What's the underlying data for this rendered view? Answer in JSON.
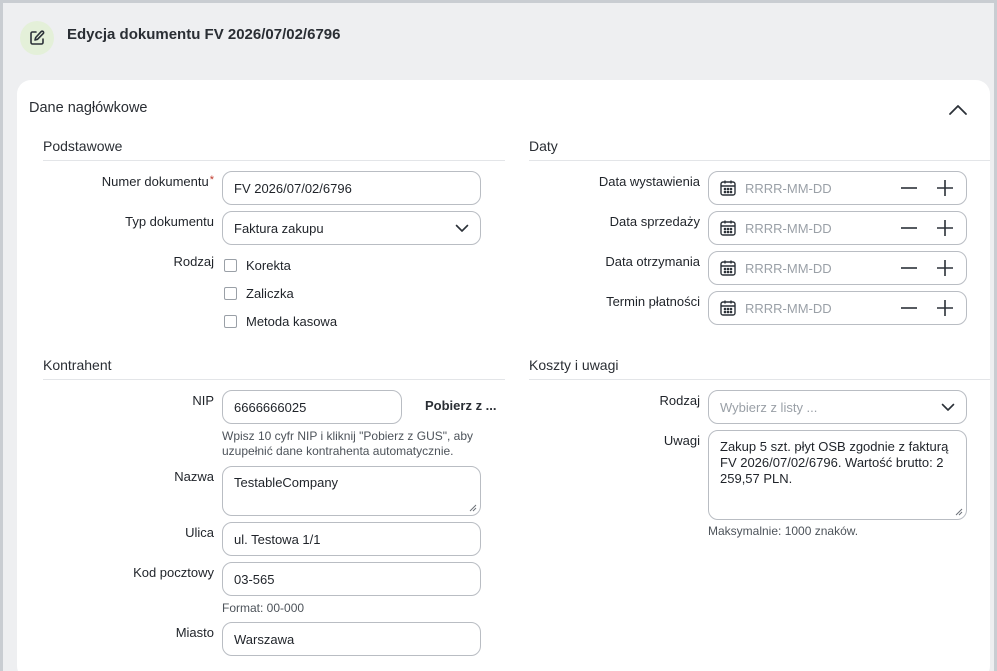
{
  "page": {
    "title": "Edycja dokumentu FV 2026/07/02/6796"
  },
  "header_section": {
    "title": "Dane nagłówkowe"
  },
  "basic": {
    "title": "Podstawowe",
    "doc_number_label": "Numer dokumentu",
    "required_mark": "*",
    "doc_number_value": "FV 2026/07/02/6796",
    "doc_type_label": "Typ dokumentu",
    "doc_type_value": "Faktura zakupu",
    "kind_label": "Rodzaj",
    "checkboxes": [
      {
        "label": "Korekta",
        "checked": false
      },
      {
        "label": "Zaliczka",
        "checked": false
      },
      {
        "label": "Metoda kasowa",
        "checked": false
      }
    ]
  },
  "dates": {
    "title": "Daty",
    "placeholder": "RRRR-MM-DD",
    "fields": [
      {
        "label": "Data wystawienia",
        "value": ""
      },
      {
        "label": "Data sprzedaży",
        "value": ""
      },
      {
        "label": "Data otrzymania",
        "value": ""
      },
      {
        "label": "Termin płatności",
        "value": ""
      }
    ]
  },
  "contractor": {
    "title": "Kontrahent",
    "nip_label": "NIP",
    "nip_value": "6666666025",
    "gus_button": "Pobierz z ...",
    "nip_hint": "Wpisz 10 cyfr NIP i kliknij \"Pobierz z GUS\", aby uzupełnić dane kontrahenta automatycznie.",
    "name_label": "Nazwa",
    "name_value": "TestableCompany",
    "street_label": "Ulica",
    "street_value": "ul. Testowa 1/1",
    "postal_label": "Kod pocztowy",
    "postal_value": "03-565",
    "postal_hint": "Format: 00-000",
    "city_label": "Miasto",
    "city_value": "Warszawa"
  },
  "costs": {
    "title": "Koszty i uwagi",
    "kind_label": "Rodzaj",
    "kind_placeholder": "Wybierz z listy ...",
    "notes_label": "Uwagi",
    "notes_value": "Zakup 5 szt. płyt OSB zgodnie z fakturą FV 2026/07/02/6796. Wartość brutto: 2 259,57 PLN.",
    "notes_hint": "Maksymalnie: 1000 znaków."
  },
  "icons": {
    "page": "edit-document-icon",
    "collapse": "chevron-up-icon",
    "select": "chevron-down-icon",
    "calendar": "calendar-icon",
    "minus": "minus-icon",
    "plus": "plus-icon"
  },
  "colors": {
    "accent_bg": "#e4f0d9",
    "required": "#c0392b",
    "border": "#b9bdc3"
  }
}
